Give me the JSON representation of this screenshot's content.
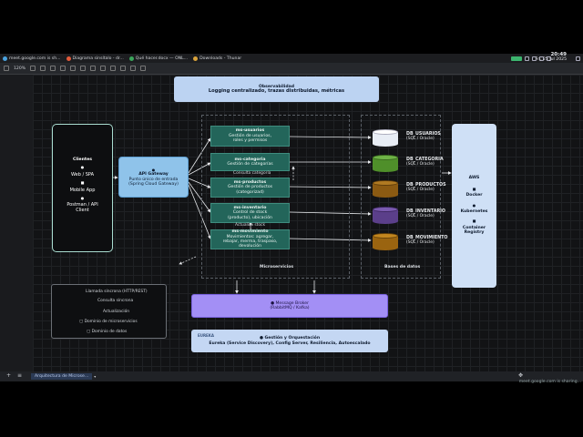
{
  "taskbar": {
    "apps": [
      {
        "label": "meet.google.com is sh...",
        "color": "#4aa3df"
      },
      {
        "label": "Diagrama sinsítalo - dr...",
        "color": "#e35a3a"
      },
      {
        "label": "Qué hacer.docx — ONL...",
        "color": "#3aa55a"
      },
      {
        "label": "Downloads - Thunar",
        "color": "#d9a33b"
      }
    ],
    "time": "20:49",
    "date": "Fri, 25 Jul 2025"
  },
  "toolbar": {
    "zoom": "120%"
  },
  "diagram": {
    "observability": {
      "title": "Observabilidad",
      "subtitle": "Logging centralizado, trazas distribuidas, métricas"
    },
    "clients": {
      "title": "Clientes",
      "items": [
        "Web / SPA",
        "Mobile App",
        "Postman / API Client"
      ]
    },
    "gateway": {
      "title": "API Gateway",
      "line1": "Punto único de entrada",
      "line2": "(Spring Cloud Gateway)"
    },
    "services": [
      {
        "name": "ms-usuarios",
        "desc1": "Gestión de usuarios,",
        "desc2": "roles y permisos"
      },
      {
        "name": "ms-categoria",
        "desc1": "Gestión de categorías",
        "desc2": ""
      },
      {
        "name": "ms-productos",
        "desc1": "Gestión de productos",
        "desc2": "(categorizad)"
      },
      {
        "name": "ms-inventario",
        "desc1": "Control de stock",
        "desc2": "(producto), ubicación"
      },
      {
        "name": "ms-movimiento",
        "desc1": "Movimientos: agregar,",
        "desc2": "rebajar, merma, traspaso, devolución"
      }
    ],
    "edge_labels": {
      "consulta": "Consulta categoría",
      "actualiza": "Actualiza stock"
    },
    "databases": [
      {
        "name": "DB_USUARIOS",
        "engine": "(SQL / Oracle)",
        "color": "#e8edf5"
      },
      {
        "name": "DB_CATEGORIA",
        "engine": "(SQL / Oracle)",
        "color": "#4f8f2a"
      },
      {
        "name": "DB_PRODUCTOS",
        "engine": "(SQL / Oracle)",
        "color": "#8b5a12"
      },
      {
        "name": "DB_INVENTARIO",
        "engine": "(SQL / Oracle)",
        "color": "#5b3f8a"
      },
      {
        "name": "DB_MOVIMIENTO",
        "engine": "(SQL / Oracle)",
        "color": "#9a6410"
      }
    ],
    "region_micro": "Microservicios",
    "region_db": "Bases de datos",
    "cloud": {
      "title": "AWS",
      "items": [
        "Docker",
        "Kubernetes",
        "Container Registry"
      ]
    },
    "legend": {
      "sync": "Llamada síncrona (HTTP/REST)",
      "query": "Consulta síncrona",
      "update": "Actualización",
      "micro_domain": "Dominio de microservicios",
      "data_domain": "Dominio de datos"
    },
    "broker": {
      "title": "Message Broker",
      "subtitle": "(RabbitMQ / Kafka)"
    },
    "orchestration": {
      "tag": "EUREKA",
      "title": "Gestión y Orquestación",
      "subtitle": "Eureka (Service Discovery), Config Server, Resiliencia, Autoescalado"
    }
  },
  "bottombar": {
    "page_tab": "Arquitectura de Microse...",
    "url": "meet.google.com is sharing..."
  }
}
